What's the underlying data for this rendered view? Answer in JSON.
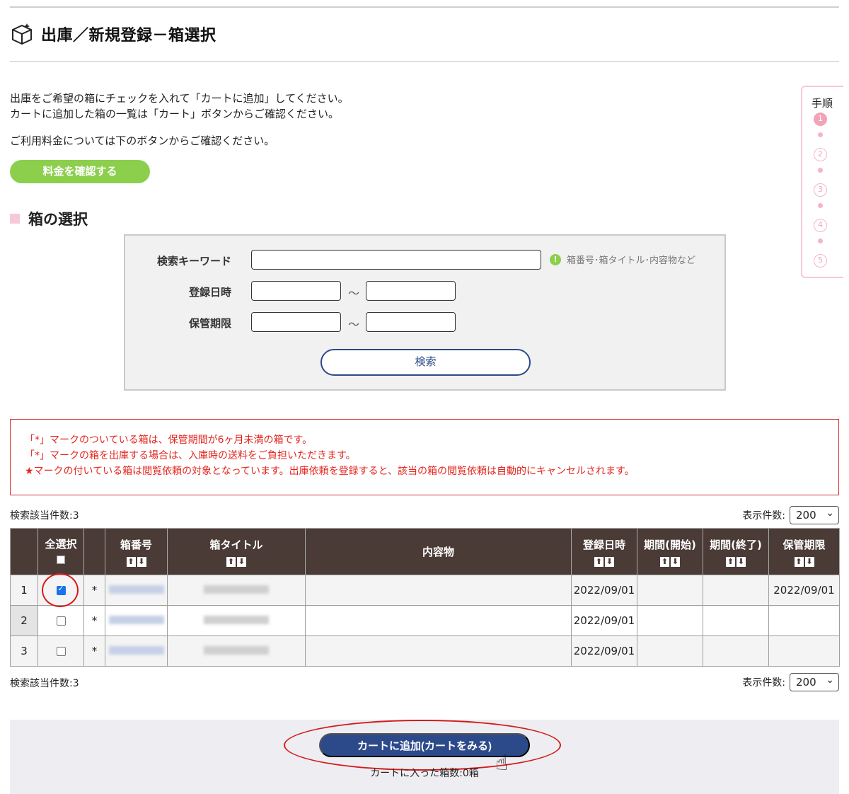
{
  "page": {
    "title": "出庫／新規登録－箱選択",
    "intro_lines": [
      "出庫をご希望の箱にチェックを入れて「カートに追加」してください。",
      "カートに追加した箱の一覧は「カート」ボタンからご確認ください。",
      "ご利用料金については下のボタンからご確認ください。"
    ],
    "fee_button": "料金を確認する",
    "section_title": "箱の選択"
  },
  "steps": {
    "label": "手順",
    "items": [
      "1",
      "2",
      "3",
      "4",
      "5"
    ],
    "active": 1
  },
  "search": {
    "keyword_label": "検索キーワード",
    "keyword_value": "",
    "keyword_hint": "箱番号･箱タイトル･内容物など",
    "hint_icon": "!",
    "reg_date_label": "登録日時",
    "storage_label": "保管期限",
    "range_sep": "～",
    "reg_from": "",
    "reg_to": "",
    "storage_from": "",
    "storage_to": "",
    "search_button": "検索"
  },
  "notice": [
    "「*」マークのついている箱は、保管期間が6ヶ月未満の箱です。",
    "「*」マークの箱を出庫する場合は、入庫時の送料をご負担いただきます。",
    "★マークの付いている箱は閲覧依頼の対象となっています。出庫依頼を登録すると、該当の箱の閲覧依頼は自動的にキャンセルされます。"
  ],
  "results": {
    "count_label": "検索該当件数:3",
    "per_page_label": "表示件数:",
    "per_page_value": "200"
  },
  "table": {
    "headers": {
      "select_all": "全選択",
      "box_no": "箱番号",
      "box_title": "箱タイトル",
      "contents": "内容物",
      "reg_date": "登録日時",
      "period_start": "期間(開始)",
      "period_end": "期間(終了)",
      "storage_limit": "保管期限"
    },
    "sort_icons": [
      "⬆",
      "⬇"
    ],
    "rows": [
      {
        "num": "1",
        "checked": true,
        "mark": "*",
        "contents": "",
        "reg_date": "2022/09/01",
        "period_start": "",
        "period_end": "",
        "storage_limit": "2022/09/01"
      },
      {
        "num": "2",
        "checked": false,
        "mark": "*",
        "contents": "",
        "reg_date": "2022/09/01",
        "period_start": "",
        "period_end": "",
        "storage_limit": ""
      },
      {
        "num": "3",
        "checked": false,
        "mark": "*",
        "contents": "",
        "reg_date": "2022/09/01",
        "period_start": "",
        "period_end": "",
        "storage_limit": ""
      }
    ]
  },
  "cart": {
    "add_button": "カートに追加(カートをみる)",
    "count_text": "カートに入った箱数:0箱"
  },
  "colors": {
    "fee_green": "#8ccf4d",
    "header_brown": "#4a3b36",
    "primary_blue": "#2c4a8a",
    "notice_red": "#e3261f",
    "step_pink": "#f3a3b8"
  }
}
